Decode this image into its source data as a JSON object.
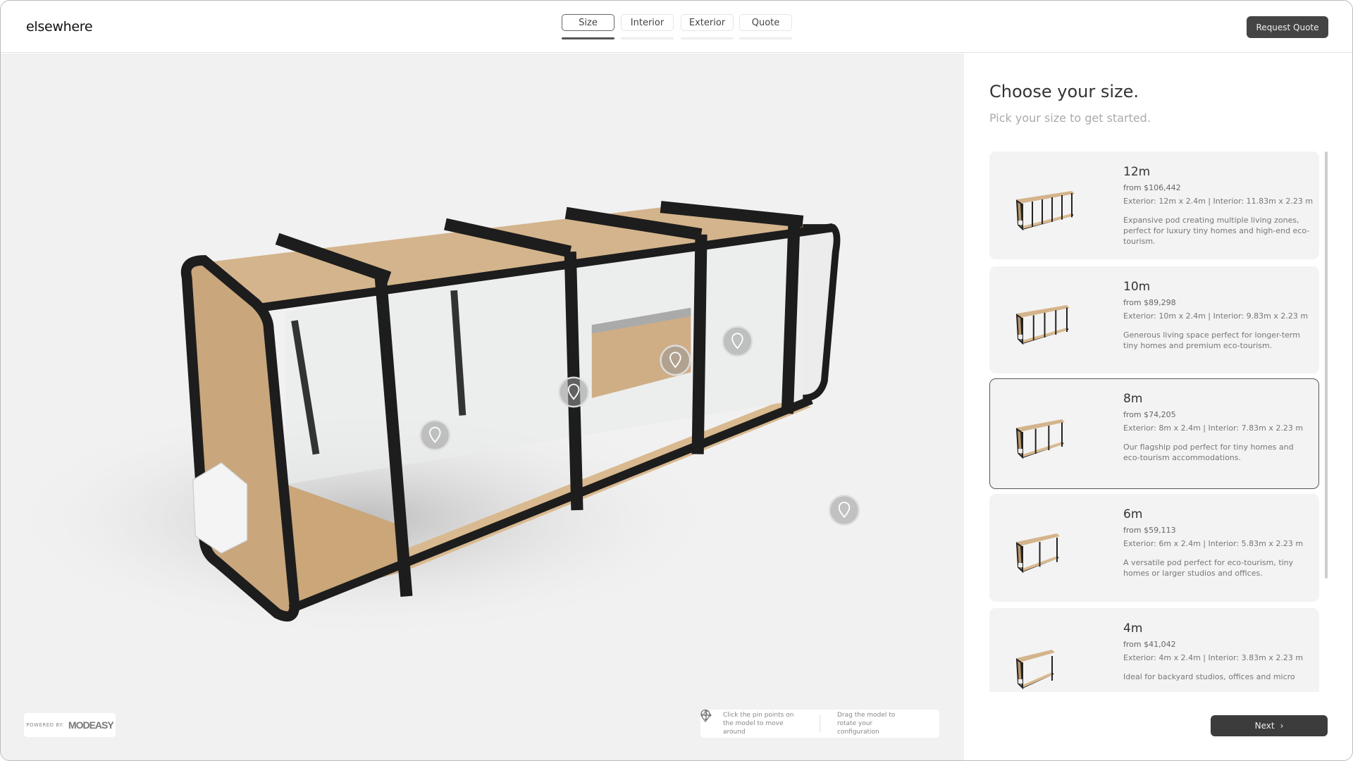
{
  "header": {
    "logo": "elsewhere",
    "tabs": [
      {
        "label": "Size",
        "active": true
      },
      {
        "label": "Interior",
        "active": false
      },
      {
        "label": "Exterior",
        "active": false
      },
      {
        "label": "Quote",
        "active": false
      }
    ],
    "request_quote": "Request Quote"
  },
  "viewer": {
    "powered_by": "POWERED BY:",
    "powered_logo": "MODEASY",
    "hint_pins": "Click the pin points on the model to move around",
    "hint_drag": "Drag the model to rotate your configuration",
    "pin_icon": "map-pin-icon",
    "drag_icon": "move-arrows-icon"
  },
  "panel": {
    "title": "Choose your size.",
    "subtitle": "Pick your size to get started.",
    "options": [
      {
        "size": "12m",
        "price": "from $106,442",
        "dims": "Exterior: 12m x 2.4m | Interior:  11.83m x 2.23 m",
        "desc": "Expansive pod creating multiple living zones, perfect for luxury tiny homes and high-end eco-tourism.",
        "selected": false
      },
      {
        "size": "10m",
        "price": "from $89,298",
        "dims": "Exterior: 10m x 2.4m | Interior:  9.83m x 2.23 m",
        "desc": "Generous living space perfect for longer-term tiny homes and premium eco-tourism.",
        "selected": false
      },
      {
        "size": "8m",
        "price": "from $74,205",
        "dims": "Exterior: 8m x 2.4m | Interior:  7.83m x 2.23 m",
        "desc": "Our flagship pod perfect for tiny homes and eco-tourism accommodations.",
        "selected": true
      },
      {
        "size": "6m",
        "price": "from $59,113",
        "dims": "Exterior: 6m x 2.4m | Interior:  5.83m x 2.23 m",
        "desc": "A versatile pod perfect for eco-tourism, tiny homes or larger studios and offices.",
        "selected": false
      },
      {
        "size": "4m",
        "price": "from $41,042",
        "dims": "Exterior: 4m x 2.4m | Interior:  3.83m x 2.23 m",
        "desc": "Ideal for backyard studios, offices and micro",
        "selected": false
      }
    ],
    "next": "Next"
  },
  "colors": {
    "primary_button": "#3c3c3c",
    "wood": "#d4b48c",
    "frame": "#222222",
    "card_bg": "#f3f3f3"
  }
}
